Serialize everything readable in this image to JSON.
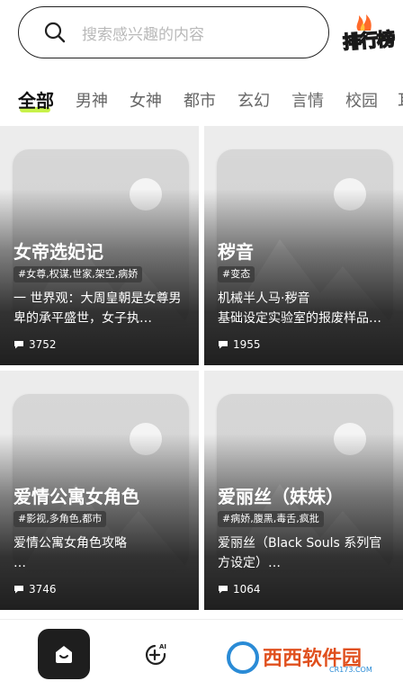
{
  "search": {
    "placeholder": "搜索感兴趣的内容"
  },
  "rank_badge": {
    "label": "排行榜"
  },
  "tabs": [
    "全部",
    "男神",
    "女神",
    "都市",
    "玄幻",
    "言情",
    "校园",
    "耳"
  ],
  "cards": [
    {
      "title": "女帝选妃记",
      "tags": "#女尊,权谋,世家,架空,病娇",
      "desc": "一 世界观：大周皇朝是女尊男卑的承平盛世，女子执…",
      "count": "3752"
    },
    {
      "title": "秽音",
      "tags": "#变态",
      "desc": "机械半人马·秽音\n基础设定实验室的报废样品…",
      "count": "1955"
    },
    {
      "title": "爱情公寓女角色",
      "tags": "#影视,多角色,都市",
      "desc": "爱情公寓女角色攻略\n…",
      "count": "3746"
    },
    {
      "title": "爱丽丝（妹妹）",
      "tags": "#病娇,腹黑,毒舌,疯批",
      "desc": "爱丽丝（Black Souls 系列官方设定）…",
      "count": "1064"
    }
  ],
  "bottom_nav": [
    {
      "name": "home",
      "icon": "home-icon"
    },
    {
      "name": "ai-create",
      "icon": "ai-plus-icon"
    }
  ],
  "watermark": {
    "text": "西西软件园",
    "sub": "CR173.COM"
  },
  "colors": {
    "accent": "#c8f24a",
    "dark": "#1e1e1e"
  }
}
